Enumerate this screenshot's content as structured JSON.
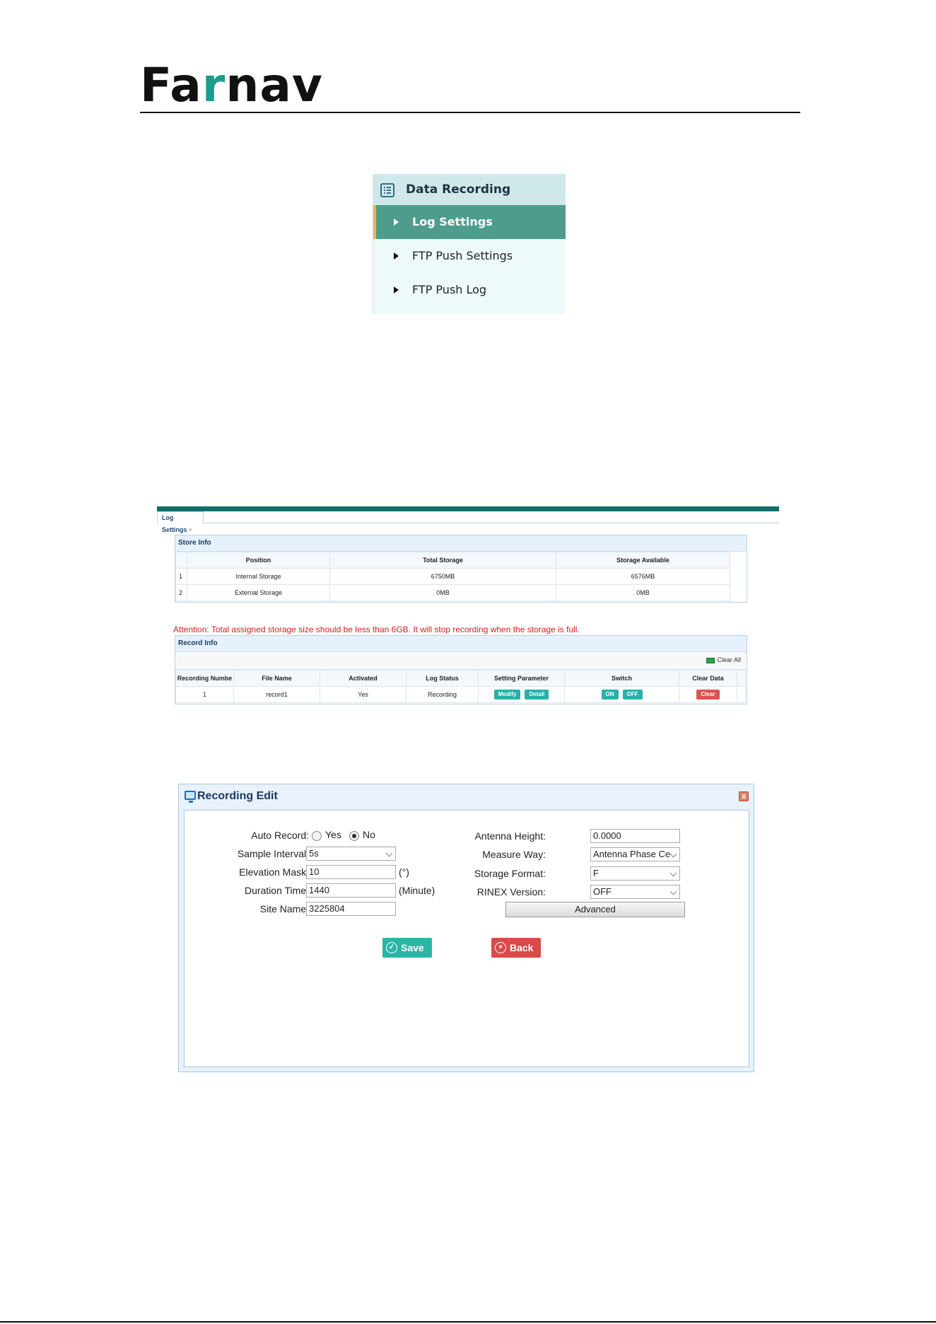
{
  "logo": {
    "pre": "Fa",
    "accent": "r",
    "post": "nav"
  },
  "menu": {
    "header": "Data Recording",
    "items": [
      {
        "label": "Log Settings",
        "active": true
      },
      {
        "label": "FTP Push Settings",
        "active": false
      },
      {
        "label": "FTP Push Log",
        "active": false
      }
    ]
  },
  "log_settings": {
    "tab_label": "Log Settings",
    "tab_close": "×",
    "store_info": {
      "title": "Store Info",
      "columns": [
        "Position",
        "Total Storage",
        "Storage Available"
      ],
      "rows": [
        {
          "num": "1",
          "position": "Internal Storage",
          "total": "6750MB",
          "available": "6576MB"
        },
        {
          "num": "2",
          "position": "External Storage",
          "total": "0MB",
          "available": "0MB"
        }
      ]
    },
    "attention": "Attention: Total assigned storage size should be less than 6GB. It will stop recording when the storage is full.",
    "record_info": {
      "title": "Record Info",
      "clear_all": "Clear All",
      "columns": [
        "Recording Numbe",
        "File Name",
        "Activated",
        "Log Status",
        "Setting Parameter",
        "Switch",
        "Clear Data"
      ],
      "rows": [
        {
          "number": "1",
          "file_name": "record1",
          "activated": "Yes",
          "log_status": "Recording",
          "modify": "Modify",
          "detail": "Detail",
          "on": "ON",
          "off": "OFF",
          "clear": "Clear"
        }
      ]
    }
  },
  "recording_edit": {
    "title": "Recording Edit",
    "close": "x",
    "auto_record": {
      "label": "Auto Record:",
      "yes": "Yes",
      "no": "No"
    },
    "sample_interval": {
      "label": "Sample Interval:",
      "value": "5s"
    },
    "elevation_mask": {
      "label": "Elevation Mask:",
      "value": "10",
      "unit": "(°)"
    },
    "duration_time": {
      "label": "Duration Time:",
      "value": "1440",
      "unit": "(Minute)"
    },
    "site_name": {
      "label": "Site Name:",
      "value": "3225804"
    },
    "antenna_height": {
      "label": "Antenna Height:",
      "value": "0.0000"
    },
    "measure_way": {
      "label": "Measure Way:",
      "value": "Antenna Phase Ce"
    },
    "storage_format": {
      "label": "Storage Format:",
      "value": "F"
    },
    "rinex_version": {
      "label": "RINEX Version:",
      "value": "OFF"
    },
    "advanced": "Advanced",
    "save": "Save",
    "back": "Back"
  }
}
